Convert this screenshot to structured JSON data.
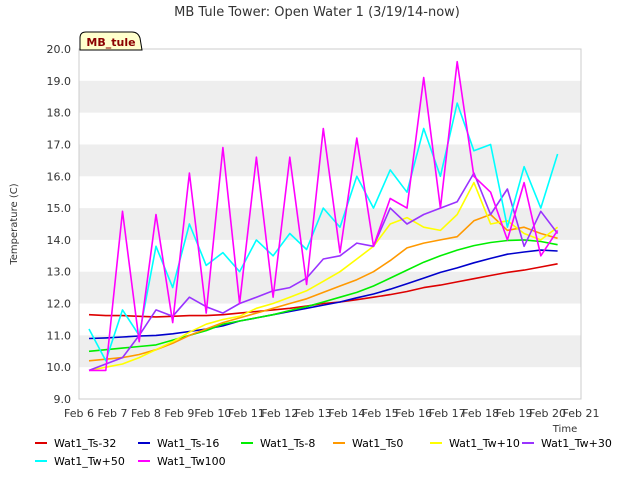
{
  "chart_data": {
    "type": "line",
    "title": "MB Tule Tower: Open Water 1 (3/19/14-now)",
    "xlabel": "Time",
    "ylabel": "Temperature (C)",
    "ylim": [
      9.0,
      20.0
    ],
    "xlim": [
      6,
      21
    ],
    "tag": "MB_tule",
    "grid": "horizontal bands",
    "legend_position": "bottom",
    "x_tick_labels": [
      "Feb 6",
      "Feb 7",
      "Feb 8",
      "Feb 9",
      "Feb 10",
      "Feb 11",
      "Feb 12",
      "Feb 13",
      "Feb 14",
      "Feb 15",
      "Feb 16",
      "Feb 17",
      "Feb 18",
      "Feb 19",
      "Feb 20",
      "Feb 21"
    ],
    "y_tick_labels": [
      "9.0",
      "10.0",
      "11.0",
      "12.0",
      "13.0",
      "14.0",
      "15.0",
      "16.0",
      "17.0",
      "18.0",
      "19.0",
      "20.0"
    ],
    "x": [
      6.3,
      6.8,
      7.3,
      7.8,
      8.3,
      8.8,
      9.3,
      9.8,
      10.3,
      10.8,
      11.3,
      11.8,
      12.3,
      12.8,
      13.3,
      13.8,
      14.3,
      14.8,
      15.3,
      15.8,
      16.3,
      16.8,
      17.3,
      17.8,
      18.3,
      18.8,
      19.3,
      19.8,
      20.3
    ],
    "series": [
      {
        "name": "Wat1_Ts-32",
        "color": "#dd0000",
        "values": [
          11.65,
          11.62,
          11.62,
          11.6,
          11.58,
          11.6,
          11.62,
          11.62,
          11.65,
          11.7,
          11.75,
          11.8,
          11.85,
          11.92,
          12.0,
          12.05,
          12.12,
          12.2,
          12.28,
          12.38,
          12.5,
          12.58,
          12.68,
          12.78,
          12.88,
          12.98,
          13.05,
          13.15,
          13.25
        ]
      },
      {
        "name": "Wat1_Ts-16",
        "color": "#0000cc",
        "values": [
          10.9,
          10.92,
          10.95,
          10.98,
          11.0,
          11.05,
          11.12,
          11.2,
          11.3,
          11.45,
          11.55,
          11.65,
          11.75,
          11.85,
          11.95,
          12.05,
          12.18,
          12.3,
          12.45,
          12.62,
          12.8,
          12.98,
          13.12,
          13.28,
          13.42,
          13.55,
          13.62,
          13.68,
          13.65
        ]
      },
      {
        "name": "Wat1_Ts-8",
        "color": "#00ee00",
        "values": [
          10.5,
          10.55,
          10.6,
          10.65,
          10.7,
          10.85,
          11.0,
          11.15,
          11.35,
          11.45,
          11.55,
          11.65,
          11.78,
          11.9,
          12.05,
          12.2,
          12.35,
          12.55,
          12.8,
          13.05,
          13.3,
          13.5,
          13.68,
          13.82,
          13.92,
          13.98,
          14.0,
          13.95,
          13.85
        ]
      },
      {
        "name": "Wat1_Ts0",
        "color": "#ff9900",
        "values": [
          10.2,
          10.25,
          10.3,
          10.4,
          10.55,
          10.75,
          11.0,
          11.2,
          11.4,
          11.55,
          11.7,
          11.85,
          12.0,
          12.15,
          12.35,
          12.55,
          12.75,
          13.0,
          13.35,
          13.75,
          13.9,
          14.0,
          14.1,
          14.6,
          14.8,
          14.3,
          14.4,
          14.2,
          14.05
        ]
      },
      {
        "name": "Wat1_Tw+10",
        "color": "#ffff00",
        "values": [
          9.9,
          10.0,
          10.1,
          10.3,
          10.55,
          10.8,
          11.1,
          11.35,
          11.5,
          11.6,
          11.85,
          12.0,
          12.2,
          12.4,
          12.7,
          13.0,
          13.4,
          13.8,
          14.5,
          14.7,
          14.4,
          14.3,
          14.8,
          15.8,
          14.5,
          14.6,
          14.2,
          14.0,
          14.4
        ]
      },
      {
        "name": "Wat1_Tw+30",
        "color": "#9933ff",
        "values": [
          9.9,
          10.1,
          10.3,
          11.0,
          11.8,
          11.6,
          12.2,
          11.9,
          11.7,
          12.0,
          12.2,
          12.4,
          12.5,
          12.8,
          13.4,
          13.5,
          13.9,
          13.8,
          15.0,
          14.5,
          14.8,
          15.0,
          15.2,
          16.1,
          14.8,
          15.6,
          13.8,
          14.9,
          14.2
        ]
      },
      {
        "name": "Wat1_Tw+50",
        "color": "#00ffff",
        "values": [
          11.2,
          10.2,
          11.8,
          11.0,
          13.8,
          12.5,
          14.5,
          13.2,
          13.6,
          13.0,
          14.0,
          13.5,
          14.2,
          13.7,
          15.0,
          14.4,
          16.0,
          15.0,
          16.2,
          15.5,
          17.5,
          16.0,
          18.3,
          16.8,
          17.0,
          14.4,
          16.3,
          15.0,
          16.7
        ]
      },
      {
        "name": "Wat1_Tw100",
        "color": "#ff00ff",
        "values": [
          9.9,
          9.9,
          14.9,
          10.8,
          14.8,
          11.4,
          16.1,
          11.7,
          16.9,
          12.0,
          16.6,
          12.2,
          16.6,
          12.6,
          17.5,
          13.6,
          17.2,
          13.8,
          15.3,
          15.0,
          19.1,
          15.0,
          19.6,
          16.0,
          15.5,
          14.0,
          15.8,
          13.5,
          14.3
        ]
      }
    ]
  }
}
